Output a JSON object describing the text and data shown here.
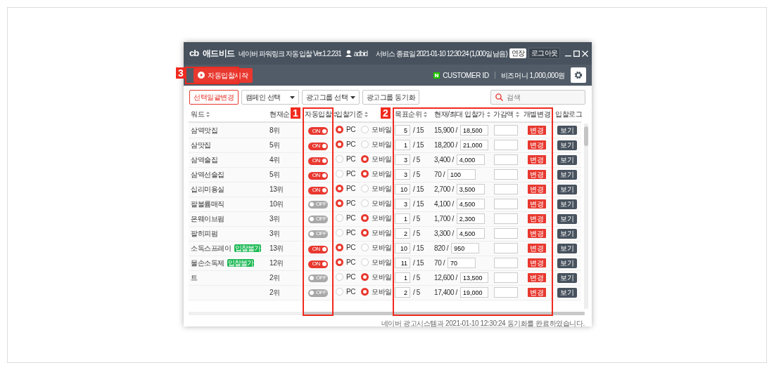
{
  "window": {
    "logo": "cb",
    "title": "애드비드",
    "subtitle": "네이버 파워링크 자동 입찰 Ver.1.2.231",
    "user": "adbid",
    "service_end": "서비스 종료일 2021-01-10 12:30:24 (1,000일 남음)",
    "extend_button": "연장",
    "logout_button": "로그아웃"
  },
  "toolbar": {
    "start_button": "자동입찰시작",
    "customer_id": "CUSTOMER ID",
    "bizmoney": "비즈머니 1,000,000원"
  },
  "filters": {
    "bulk_button": "선택일괄변경",
    "campaign_select": "캠페인 선택",
    "adgroup_select": "광고그룹 선택",
    "sync_button": "광고그룹 동기화",
    "search": {
      "placeholder": "검색"
    }
  },
  "table": {
    "columns": [
      {
        "label": "워드",
        "sortable": true
      },
      {
        "label": "현재순",
        "sortable": false
      },
      {
        "label": "자동입찰",
        "sortable": true
      },
      {
        "label": "입찰기준",
        "sortable": true
      },
      {
        "label": "목표순위",
        "sortable": true
      },
      {
        "label": "현재/최대 입찰가",
        "sortable": true
      },
      {
        "label": "가감액",
        "sortable": true
      },
      {
        "label": "개별변경",
        "sortable": false
      },
      {
        "label": "입찰로그",
        "sortable": false
      }
    ],
    "rows": [
      {
        "keyword": "삼역맛집",
        "rank": "8위",
        "auto_bid": true,
        "toggle": "ON",
        "basis": [
          {
            "label": "PC",
            "selected": true
          },
          {
            "label": "모바일",
            "selected": false
          }
        ],
        "target": "5",
        "target_max": "/ 15",
        "current_bid": "15,900 /",
        "max_bid": "18,500",
        "change_button": "변경",
        "log_button": "보기"
      },
      {
        "keyword": "삼맛집",
        "rank": "5위",
        "auto_bid": true,
        "toggle": "ON",
        "basis": [
          {
            "label": "PC",
            "selected": true
          },
          {
            "label": "모바일",
            "selected": false
          }
        ],
        "target": "1",
        "target_max": "/ 15",
        "current_bid": "18,200 /",
        "max_bid": "21,000",
        "change_button": "변경",
        "log_button": "보기"
      },
      {
        "keyword": "삼역술집",
        "rank": "4위",
        "auto_bid": true,
        "toggle": "ON",
        "basis": [
          {
            "label": "PC",
            "selected": false
          },
          {
            "label": "모바일",
            "selected": true
          }
        ],
        "target": "3",
        "target_max": "/ 5",
        "current_bid": "3,400 /",
        "max_bid": "4,000",
        "change_button": "변경",
        "log_button": "보기"
      },
      {
        "keyword": "삼역선술집",
        "rank": "5위",
        "auto_bid": true,
        "toggle": "ON",
        "basis": [
          {
            "label": "PC",
            "selected": false
          },
          {
            "label": "모바일",
            "selected": true
          }
        ],
        "target": "3",
        "target_max": "/ 5",
        "current_bid": "70 /",
        "max_bid": "100",
        "change_button": "변경",
        "log_button": "보기"
      },
      {
        "keyword": "십리미용실",
        "rank": "13위",
        "auto_bid": true,
        "toggle": "ON",
        "basis": [
          {
            "label": "PC",
            "selected": true
          },
          {
            "label": "모바일",
            "selected": false
          }
        ],
        "target": "10",
        "target_max": "/ 15",
        "current_bid": "2,700 /",
        "max_bid": "3,500",
        "change_button": "변경",
        "log_button": "보기"
      },
      {
        "keyword": "팔볼륨매직",
        "rank": "10위",
        "auto_bid": false,
        "toggle": "OFF",
        "basis": [
          {
            "label": "PC",
            "selected": true
          },
          {
            "label": "모바일",
            "selected": false
          }
        ],
        "target": "3",
        "target_max": "/ 15",
        "current_bid": "4,100 /",
        "max_bid": "4,500",
        "change_button": "변경",
        "log_button": "보기"
      },
      {
        "keyword": "은웨이브펌",
        "rank": "3위",
        "auto_bid": false,
        "toggle": "OFF",
        "basis": [
          {
            "label": "PC",
            "selected": false
          },
          {
            "label": "모바일",
            "selected": true
          }
        ],
        "target": "1",
        "target_max": "/ 5",
        "current_bid": "1,700 /",
        "max_bid": "2,300",
        "change_button": "변경",
        "log_button": "보기"
      },
      {
        "keyword": "팔히피펌",
        "rank": "3위",
        "auto_bid": false,
        "toggle": "OFF",
        "basis": [
          {
            "label": "PC",
            "selected": false
          },
          {
            "label": "모바일",
            "selected": true
          }
        ],
        "target": "2",
        "target_max": "/ 5",
        "current_bid": "3,300 /",
        "max_bid": "4,500",
        "change_button": "변경",
        "log_button": "보기"
      },
      {
        "keyword": "소독스프레이",
        "badge": "입찰불가",
        "rank": "13위",
        "auto_bid": true,
        "toggle": "ON",
        "basis": [
          {
            "label": "PC",
            "selected": true
          },
          {
            "label": "모바일",
            "selected": false
          }
        ],
        "target": "10",
        "target_max": "/ 15",
        "current_bid": "820 /",
        "max_bid": "950",
        "change_button": "변경",
        "log_button": "보기"
      },
      {
        "keyword": "물손소독제",
        "badge": "입찰불가",
        "rank": "12위",
        "auto_bid": true,
        "toggle": "ON",
        "basis": [
          {
            "label": "PC",
            "selected": true
          },
          {
            "label": "모바일",
            "selected": false
          }
        ],
        "target": "11",
        "target_max": "/ 15",
        "current_bid": "70 /",
        "max_bid": "70",
        "change_button": "변경",
        "log_button": "보기"
      },
      {
        "keyword": "트",
        "rank": "2위",
        "auto_bid": false,
        "toggle": "OFF",
        "basis": [
          {
            "label": "PC",
            "selected": false
          },
          {
            "label": "모바일",
            "selected": true
          }
        ],
        "target": "1",
        "target_max": "/ 5",
        "current_bid": "12,600 /",
        "max_bid": "13,500",
        "change_button": "변경",
        "log_button": "보기"
      },
      {
        "rank": "2위",
        "auto_bid": false,
        "toggle": "OFF",
        "basis": [
          {
            "label": "PC",
            "selected": false
          },
          {
            "label": "모바일",
            "selected": true
          }
        ],
        "target": "2",
        "target_max": "/ 5",
        "current_bid": "17,400 /",
        "max_bid": "19,000",
        "change_button": "변경",
        "log_button": "보기"
      }
    ]
  },
  "status_bar": "네이버 광고시스템과 2021-01-10 12:30:24 동기화를 완료하였습니다.",
  "annotations": [
    {
      "number": "1"
    },
    {
      "number": "2"
    },
    {
      "number": "3"
    }
  ]
}
